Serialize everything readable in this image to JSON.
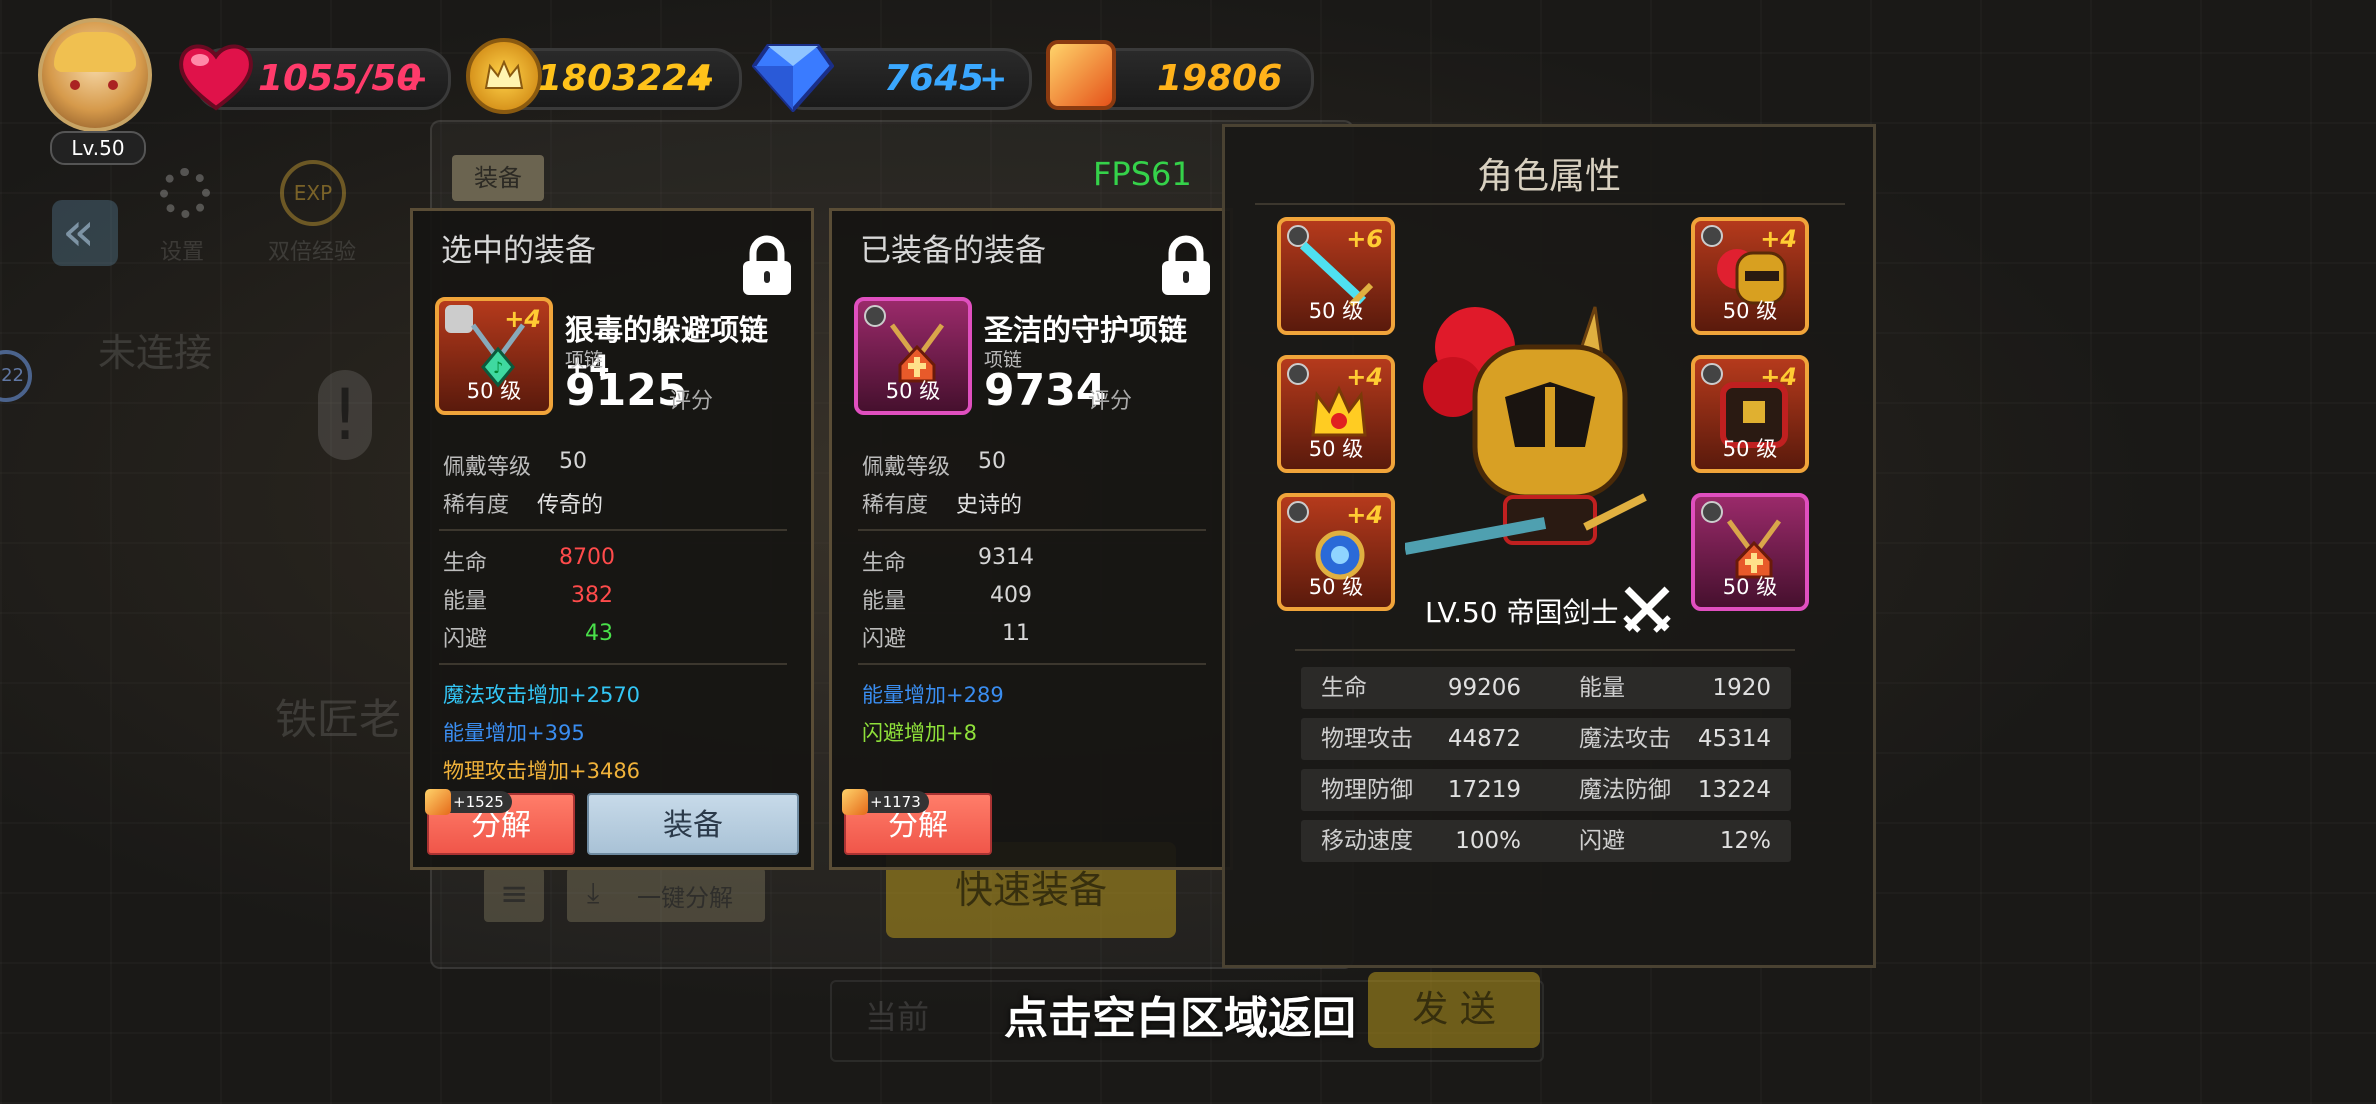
{
  "player": {
    "level": "Lv.50"
  },
  "resources": {
    "hp": "1055/50",
    "gold": "1803224",
    "gems": "7645",
    "materials": "19806",
    "plus": "+"
  },
  "fps": "FPS61",
  "background": {
    "tab_equipment": "装备",
    "settings": "设置",
    "double_exp": "双倍经验",
    "disconnected": "未连接",
    "blacksmith": "铁匠老",
    "quick_equip": "快速装备",
    "one_key_decompose": "一键分解",
    "current": "当前",
    "send": "发 送",
    "level_badge": "22",
    "exp_badge": "EXP"
  },
  "selected": {
    "panel_title": "选中的装备",
    "name": "狠毒的躲避项链+4",
    "type": "项链",
    "score": "9125",
    "score_unit": "评分",
    "level_tag": "50 级",
    "plus": "+4",
    "wear_level_label": "佩戴等级",
    "wear_level": "50",
    "rarity_label": "稀有度",
    "rarity": "传奇的",
    "stats": [
      {
        "label": "生命",
        "value": "8700",
        "color": "#ff4b4b"
      },
      {
        "label": "能量",
        "value": "382",
        "color": "#ff4b4b"
      },
      {
        "label": "闪避",
        "value": "43",
        "color": "#49e04a"
      }
    ],
    "bonuses": [
      {
        "text": "魔法攻击增加+2570",
        "color": "#33c6f5"
      },
      {
        "text": "能量增加+395",
        "color": "#3a8df0"
      },
      {
        "text": "物理攻击增加+3486",
        "color": "#f0b23a"
      }
    ],
    "decompose_reward": "+1525",
    "decompose_label": "分解",
    "equip_label": "装备"
  },
  "equipped": {
    "panel_title": "已装备的装备",
    "name": "圣洁的守护项链",
    "type": "项链",
    "score": "9734",
    "score_unit": "评分",
    "level_tag": "50 级",
    "wear_level_label": "佩戴等级",
    "wear_level": "50",
    "rarity_label": "稀有度",
    "rarity": "史诗的",
    "stats": [
      {
        "label": "生命",
        "value": "9314"
      },
      {
        "label": "能量",
        "value": "409"
      },
      {
        "label": "闪避",
        "value": "11"
      }
    ],
    "bonuses": [
      {
        "text": "能量增加+289",
        "color": "#3a8df0"
      },
      {
        "text": "闪避增加+8",
        "color": "#8ee03a"
      }
    ],
    "decompose_reward": "+1173",
    "decompose_label": "分解"
  },
  "character": {
    "panel_title": "角色属性",
    "name": "LV.50 帝国剑士",
    "slots": [
      {
        "slot": "weapon",
        "plus": "+6",
        "level": "50 级",
        "rarity": "legendary"
      },
      {
        "slot": "helmet",
        "plus": "+4",
        "level": "50 级",
        "rarity": "legendary"
      },
      {
        "slot": "ring",
        "plus": "+4",
        "level": "50 级",
        "rarity": "legendary"
      },
      {
        "slot": "armor",
        "plus": "+4",
        "level": "50 级",
        "rarity": "legendary"
      },
      {
        "slot": "amulet",
        "plus": "+4",
        "level": "50 级",
        "rarity": "legendary"
      },
      {
        "slot": "necklace",
        "plus": "",
        "level": "50 级",
        "rarity": "epic"
      }
    ],
    "stats": [
      {
        "l1": "生命",
        "v1": "99206",
        "l2": "能量",
        "v2": "1920"
      },
      {
        "l1": "物理攻击",
        "v1": "44872",
        "l2": "魔法攻击",
        "v2": "45314"
      },
      {
        "l1": "物理防御",
        "v1": "17219",
        "l2": "魔法防御",
        "v2": "13224"
      },
      {
        "l1": "移动速度",
        "v1": "100%",
        "l2": "闪避",
        "v2": "12%"
      }
    ]
  },
  "hint": "点击空白区域返回",
  "colors": {
    "legendary_border": "#f0a43a",
    "epic_border": "#e04fbf",
    "fps": "#35d24a",
    "hp_text": "#ff3b6b",
    "gold_text": "#ffc21a",
    "gem_text": "#3aa8ff",
    "material_text": "#ffb21a"
  }
}
